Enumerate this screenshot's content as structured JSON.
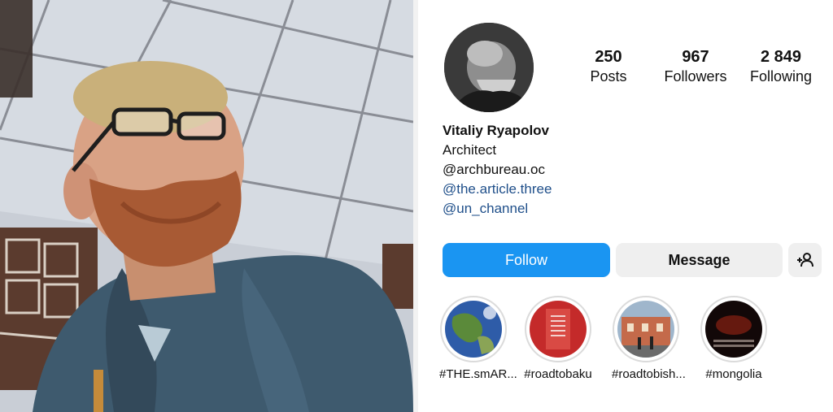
{
  "profile": {
    "stats": [
      {
        "value": "250",
        "label": "Posts"
      },
      {
        "value": "967",
        "label": "Followers"
      },
      {
        "value": "2 849",
        "label": "Following"
      }
    ],
    "name": "Vitaliy Ryapolov",
    "bio_lines": [
      "Architect",
      "@archbureau.oc"
    ],
    "links": [
      "@the.article.three",
      "@un_channel"
    ],
    "buttons": {
      "follow": "Follow",
      "message": "Message",
      "add_user_icon": "add-person-icon"
    },
    "highlights": [
      {
        "caption": "#THE.smAR..."
      },
      {
        "caption": "#roadtobaku"
      },
      {
        "caption": "#roadtobish..."
      },
      {
        "caption": "#mongolia"
      }
    ]
  },
  "colors": {
    "follow_button": "#1a95f2",
    "secondary_button": "#efefef",
    "link": "#1f4f8a"
  }
}
